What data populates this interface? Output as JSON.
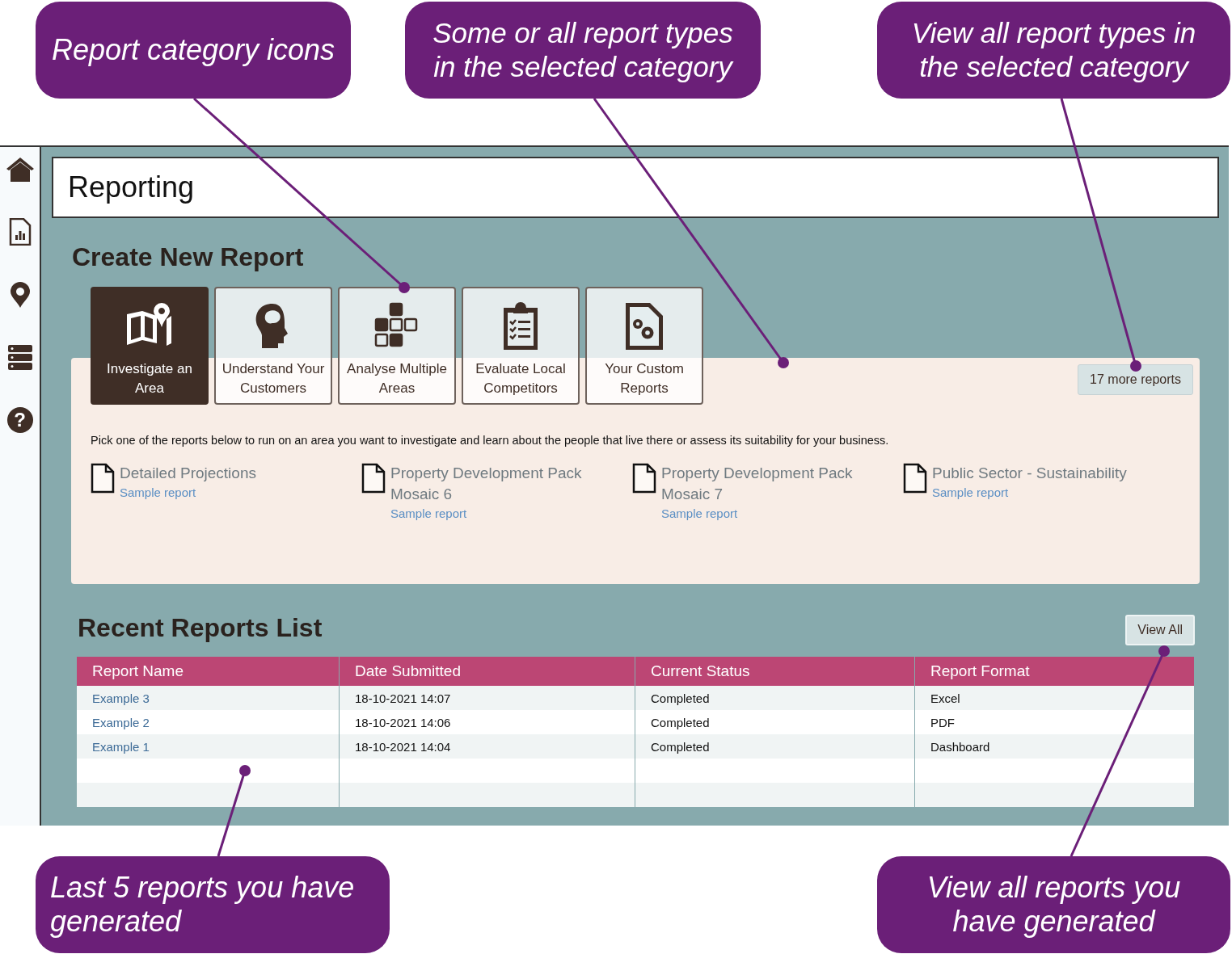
{
  "callouts": [
    {
      "text": "Report category icons"
    },
    {
      "text": "Some or all report types in the selected category"
    },
    {
      "text": "View all report types in the selected category"
    },
    {
      "text": "Last 5 reports you have generated"
    },
    {
      "text": "View all reports you have generated"
    }
  ],
  "sidebar": {
    "help_glyph": "?"
  },
  "page_title": "Reporting",
  "create": {
    "heading": "Create New Report",
    "categories": [
      {
        "label": "Investigate an Area",
        "selected": true
      },
      {
        "label": "Understand Your Customers",
        "selected": false
      },
      {
        "label": "Analyse Multiple Areas",
        "selected": false
      },
      {
        "label": "Evaluate Local Competitors",
        "selected": false
      },
      {
        "label": "Your Custom Reports",
        "selected": false
      }
    ],
    "more_button": "17 more reports",
    "description": "Pick one of the reports below to run on an area you want to investigate and learn about the people that live there or assess its suitability for your business.",
    "reports": [
      {
        "title": "Detailed Projections",
        "link": "Sample report"
      },
      {
        "title": "Property Development Pack Mosaic 6",
        "link": "Sample report"
      },
      {
        "title": "Property Development Pack Mosaic 7",
        "link": "Sample report"
      },
      {
        "title": "Public Sector - Sustainability",
        "link": "Sample report"
      }
    ]
  },
  "recent": {
    "heading": "Recent Reports List",
    "view_all": "View All",
    "columns": [
      "Report Name",
      "Date Submitted",
      "Current Status",
      "Report Format"
    ],
    "rows": [
      [
        "Example 3",
        "18-10-2021 14:07",
        "Completed",
        "Excel"
      ],
      [
        "Example 2",
        "18-10-2021 14:06",
        "Completed",
        "PDF"
      ],
      [
        "Example 1",
        "18-10-2021 14:04",
        "Completed",
        "Dashboard"
      ]
    ]
  }
}
